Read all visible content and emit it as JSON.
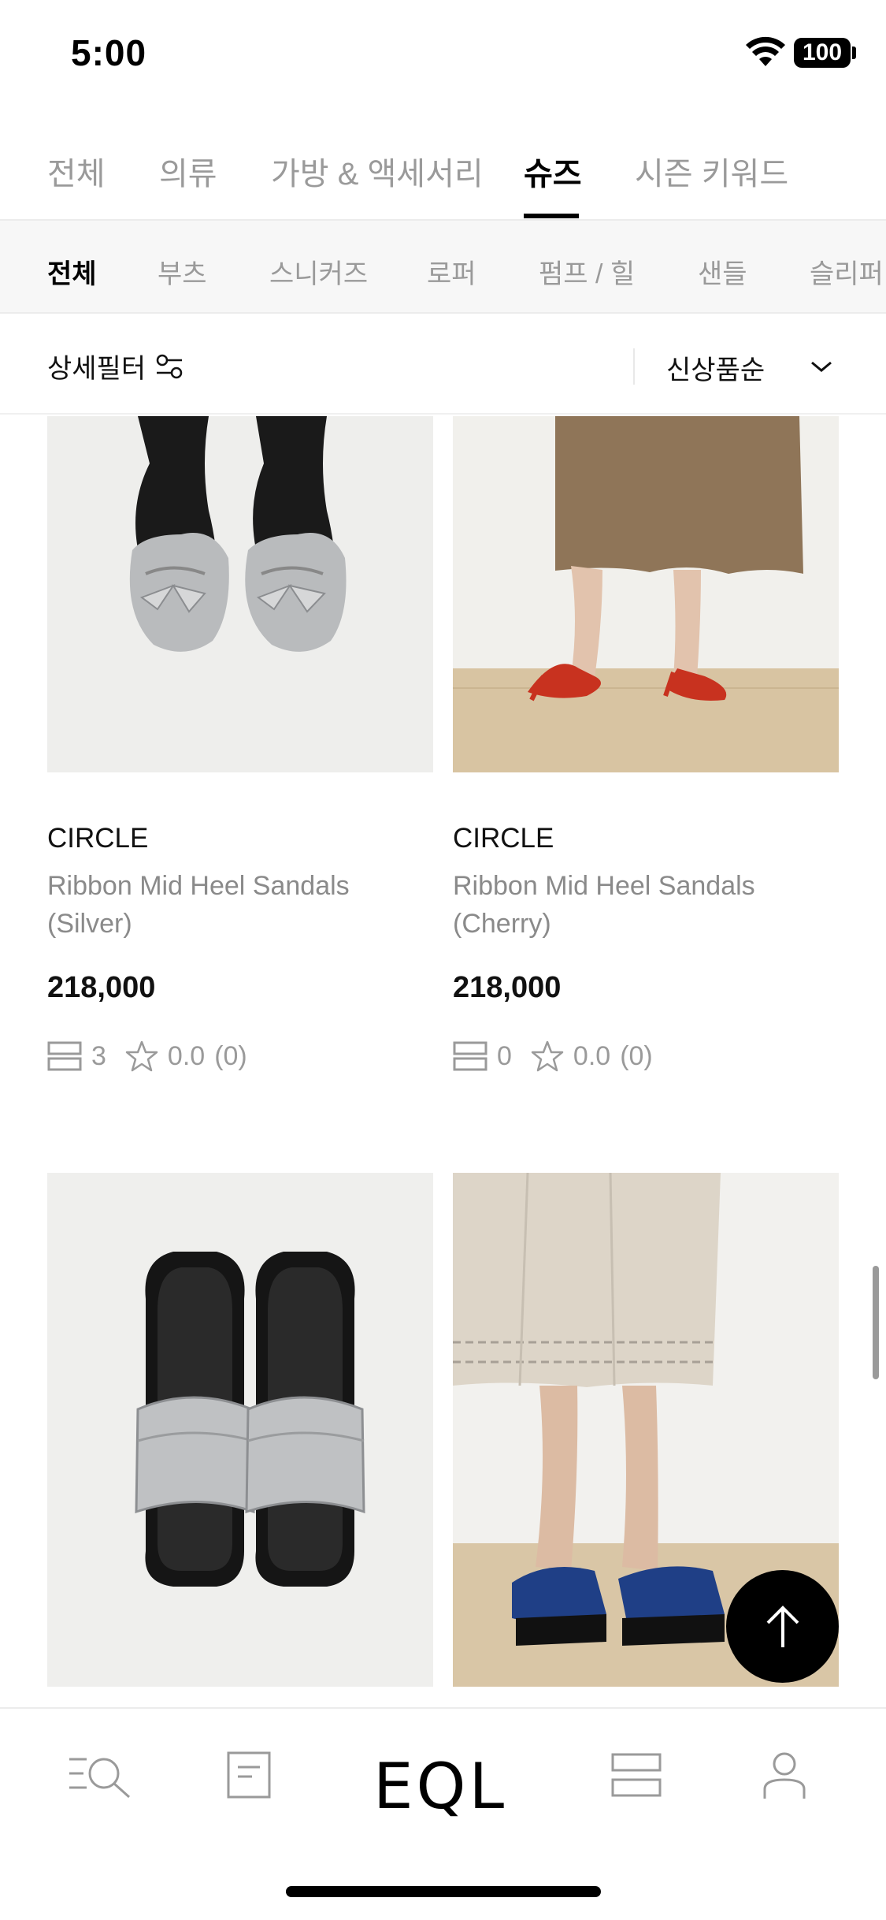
{
  "status": {
    "time": "5:00",
    "battery": "100"
  },
  "category_tabs": [
    {
      "label": "전체"
    },
    {
      "label": "의류"
    },
    {
      "label": "가방 & 액세서리"
    },
    {
      "label": "슈즈"
    },
    {
      "label": "시즌 키워드"
    }
  ],
  "category_active": "슈즈",
  "sub_tabs": [
    {
      "label": "전체"
    },
    {
      "label": "부츠"
    },
    {
      "label": "스니커즈"
    },
    {
      "label": "로퍼"
    },
    {
      "label": "펌프 / 힐"
    },
    {
      "label": "샌들"
    },
    {
      "label": "슬리퍼"
    }
  ],
  "sub_active": "전체",
  "filter": {
    "label": "상세필터",
    "sort": "신상품순"
  },
  "products": [
    {
      "brand": "CIRCLE",
      "name": "Ribbon Mid Heel Sandals (Silver)",
      "price": "218,000",
      "reviews_count": "3",
      "rating": "0.0",
      "rating_count": "(0)"
    },
    {
      "brand": "CIRCLE",
      "name": "Ribbon Mid Heel Sandals (Cherry)",
      "price": "218,000",
      "reviews_count": "0",
      "rating": "0.0",
      "rating_count": "(0)"
    },
    {
      "brand": "",
      "name": "",
      "price": "",
      "reviews_count": "",
      "rating": "",
      "rating_count": ""
    },
    {
      "brand": "",
      "name": "",
      "price": "",
      "reviews_count": "",
      "rating": "",
      "rating_count": ""
    }
  ],
  "bottom_nav": {
    "logo": "EQL",
    "icons": [
      "search-menu-icon",
      "document-icon",
      "layers-icon",
      "user-icon"
    ]
  },
  "colors": {
    "accent": "#000000",
    "muted": "#9a9a9a",
    "subtab_bg": "#f7f7f7"
  }
}
